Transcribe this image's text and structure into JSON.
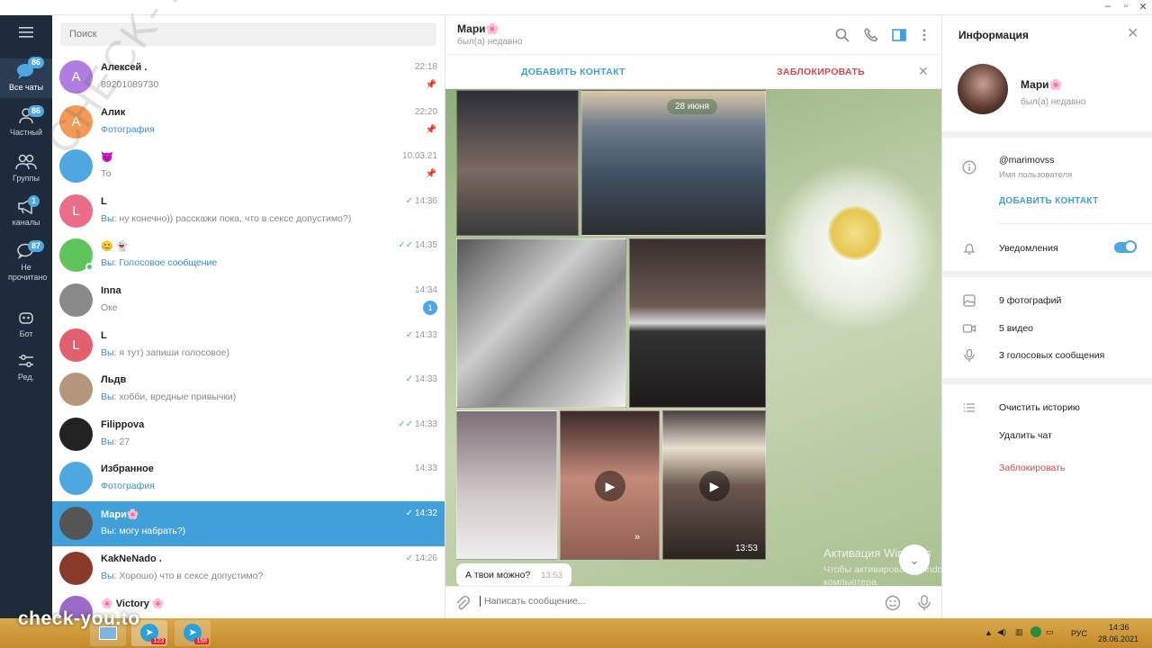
{
  "rail": {
    "items": [
      {
        "label": "Все чаты",
        "badge": "86",
        "icon": "chats-icon"
      },
      {
        "label": "Частный",
        "badge": "86",
        "icon": "person-icon"
      },
      {
        "label": "Группы",
        "badge": "",
        "icon": "group-icon"
      },
      {
        "label": "каналы",
        "badge": "1",
        "icon": "megaphone-icon"
      },
      {
        "label": "Не прочитано",
        "badge": "87",
        "icon": "unread-chat-icon"
      },
      {
        "label": "Бот",
        "badge": "",
        "icon": "bot-icon"
      },
      {
        "label": "Ред.",
        "badge": "",
        "icon": "sliders-icon"
      }
    ]
  },
  "search": {
    "placeholder": "Поиск"
  },
  "chats": [
    {
      "name": "Алексей .",
      "message": "89201089730",
      "you": "",
      "time": "22:18",
      "pinned": true,
      "check": "",
      "badge": "",
      "avatar_letter": "А",
      "avatar_color": "#b07ee0"
    },
    {
      "name": "Алик",
      "message": "Фотография",
      "you": "",
      "time": "22:20",
      "pinned": true,
      "check": "",
      "badge": "",
      "avatar_letter": "А",
      "avatar_color": "#f39a57",
      "msg_link": true
    },
    {
      "name": "😈",
      "message": "То",
      "you": "",
      "time": "10.03.21",
      "pinned": true,
      "check": "",
      "badge": "",
      "avatar_letter": "",
      "avatar_color": "#4fa7e0"
    },
    {
      "name": "L",
      "message": "ну конечно)) расскажи пока, что в сексе допустимо?)",
      "you": "Вы: ",
      "time": "14:36",
      "pinned": false,
      "check": "✓",
      "badge": "",
      "avatar_letter": "L",
      "avatar_color": "#ec6d8a"
    },
    {
      "name": "😊 👻",
      "message": "Голосовое сообщение",
      "you": "Вы: ",
      "time": "14:35",
      "pinned": false,
      "check": "✓✓",
      "badge": "",
      "avatar_letter": "",
      "avatar_color": "#5fc55a",
      "online": true,
      "msg_link": true
    },
    {
      "name": "Inna",
      "message": "Оке",
      "you": "",
      "time": "14:34",
      "pinned": false,
      "check": "",
      "badge": "1",
      "avatar_letter": "",
      "avatar_color": "#8a8a8a"
    },
    {
      "name": "L",
      "message": "я тут) запиши голосовое)",
      "you": "Вы: ",
      "time": "14:33",
      "pinned": false,
      "check": "✓",
      "badge": "",
      "avatar_letter": "L",
      "avatar_color": "#e2606d"
    },
    {
      "name": "Льдв",
      "message": "хобби, вредные привычки)",
      "you": "Вы: ",
      "time": "14:33",
      "pinned": false,
      "check": "✓",
      "badge": "",
      "avatar_letter": "",
      "avatar_color": "#b4977a"
    },
    {
      "name": "Filippova",
      "message": "27",
      "you": "Вы: ",
      "time": "14:33",
      "pinned": false,
      "check": "✓✓",
      "badge": "",
      "avatar_letter": "",
      "avatar_color": "#222222"
    },
    {
      "name": "Избранное",
      "message": "Фотография",
      "you": "",
      "time": "14:33",
      "pinned": false,
      "check": "",
      "badge": "",
      "avatar_letter": "",
      "avatar_color": "#4fa7e0",
      "msg_link": true
    },
    {
      "name": "Мари🌸",
      "message": "могу набрать?)",
      "you": "Вы: ",
      "time": "14:32",
      "pinned": false,
      "check": "✓",
      "badge": "",
      "avatar_letter": "",
      "avatar_color": "#555555",
      "selected": true
    },
    {
      "name": "KakNeNado .",
      "message": "Хорошо) что в сексе допустимо?",
      "you": "Вы: ",
      "time": "14:26",
      "pinned": false,
      "check": "✓",
      "badge": "",
      "avatar_letter": "",
      "avatar_color": "#8a3a2a"
    },
    {
      "name": "🌸 Victory 🌸",
      "message": "",
      "you": "",
      "time": "",
      "pinned": false,
      "check": "",
      "badge": "",
      "avatar_letter": "",
      "avatar_color": "#9b6ac9"
    }
  ],
  "chat": {
    "name": "Мари🌸",
    "status": "был(а) недавно",
    "add_contact": "ДОБАВИТЬ КОНТАКТ",
    "block": "ЗАБЛОКИРОВАТЬ",
    "date_pill": "28 июня",
    "video_duration": "13:53",
    "message": {
      "text": "А твои можно?",
      "time": "13:53"
    },
    "watermark_title": "Активация Windows",
    "watermark_text": "Чтобы активировать Windows, перейдите к параметрам компьютера.",
    "compose_placeholder": "Написать сообщение..."
  },
  "info": {
    "title": "Информация",
    "name": "Мари🌸",
    "status": "был(а) недавно",
    "username": "@marimovss",
    "username_label": "Имя пользователя",
    "add_contact": "ДОБАВИТЬ КОНТАКТ",
    "notifications": "Уведомления",
    "notifications_on": true,
    "photos": "9 фотографий",
    "videos": "5 видео",
    "voice": "3 голосовых сообщения",
    "clear_history": "Очистить историю",
    "delete_chat": "Удалить чат",
    "block": "Заблокировать"
  },
  "taskbar": {
    "app_badge_1": "123",
    "app_badge_2": "158",
    "lang": "РУС",
    "time": "14:36",
    "date": "28.06.2021"
  },
  "overlay": {
    "brand": "check-you.to",
    "diagonal": "CHECK-YOU.ME"
  },
  "colors": {
    "accent": "#419fd9",
    "rail": "#1e2b3a",
    "danger": "#d94a4a"
  }
}
